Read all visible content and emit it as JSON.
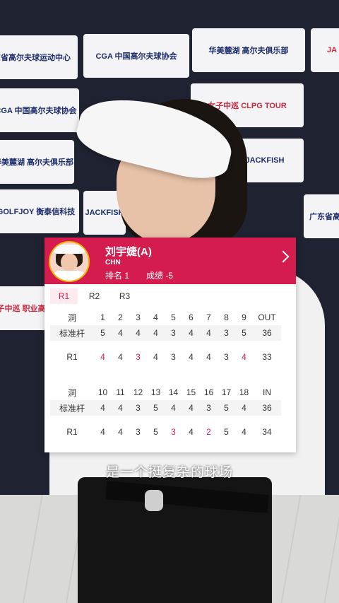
{
  "backdrop": {
    "sponsors": [
      {
        "text": "东省高尔夫球运动中心",
        "style": "blue"
      },
      {
        "text": "CGA 中国高尔夫球协会",
        "style": "blue"
      },
      {
        "text": "华美麓湖 高尔夫俱乐部",
        "style": "blue"
      },
      {
        "text": "JA",
        "style": "red"
      },
      {
        "text": "CGA 中国高尔夫球协会",
        "style": "blue"
      },
      {
        "text": "女子中巡 CLPG TOUR",
        "style": "red"
      },
      {
        "text": "华美麓湖 高尔夫俱乐部",
        "style": "blue"
      },
      {
        "text": "JACKFISH",
        "style": "blue"
      },
      {
        "text": "GOLFJOY 衡泰信科技",
        "style": "blue"
      },
      {
        "text": "JACKFISH",
        "style": "blue"
      },
      {
        "text": "广东省高",
        "style": "blue"
      },
      {
        "text": "女子中巡 职业高尔",
        "style": "red"
      }
    ]
  },
  "card": {
    "player_name": "刘宇婕(A)",
    "country": "CHN",
    "rank_label": "排名 1",
    "score_label": "成绩 -5",
    "tabs": [
      "R1",
      "R2",
      "R3"
    ],
    "active_tab": "R1",
    "front": {
      "hole_label": "洞",
      "holes": [
        "1",
        "2",
        "3",
        "4",
        "5",
        "6",
        "7",
        "8",
        "9"
      ],
      "total_label": "OUT",
      "par_label": "标准杆",
      "pars": [
        "5",
        "4",
        "4",
        "4",
        "3",
        "4",
        "4",
        "3",
        "5"
      ],
      "par_total": "36",
      "round_label": "R1",
      "scores": [
        "4",
        "4",
        "3",
        "4",
        "3",
        "4",
        "4",
        "3",
        "4"
      ],
      "score_total": "33"
    },
    "back": {
      "hole_label": "洞",
      "holes": [
        "10",
        "11",
        "12",
        "13",
        "14",
        "15",
        "16",
        "17",
        "18"
      ],
      "total_label": "IN",
      "par_label": "标准杆",
      "pars": [
        "4",
        "4",
        "3",
        "5",
        "4",
        "4",
        "3",
        "5",
        "4"
      ],
      "par_total": "36",
      "round_label": "R1",
      "scores": [
        "4",
        "4",
        "3",
        "5",
        "3",
        "4",
        "2",
        "5",
        "4"
      ],
      "score_total": "34"
    },
    "colors": {
      "accent": "#d41c4f",
      "birdie": "#d41c4f",
      "tab_bg": "#fdebf0"
    }
  },
  "subtitle": "是一个挺复杂的球场"
}
